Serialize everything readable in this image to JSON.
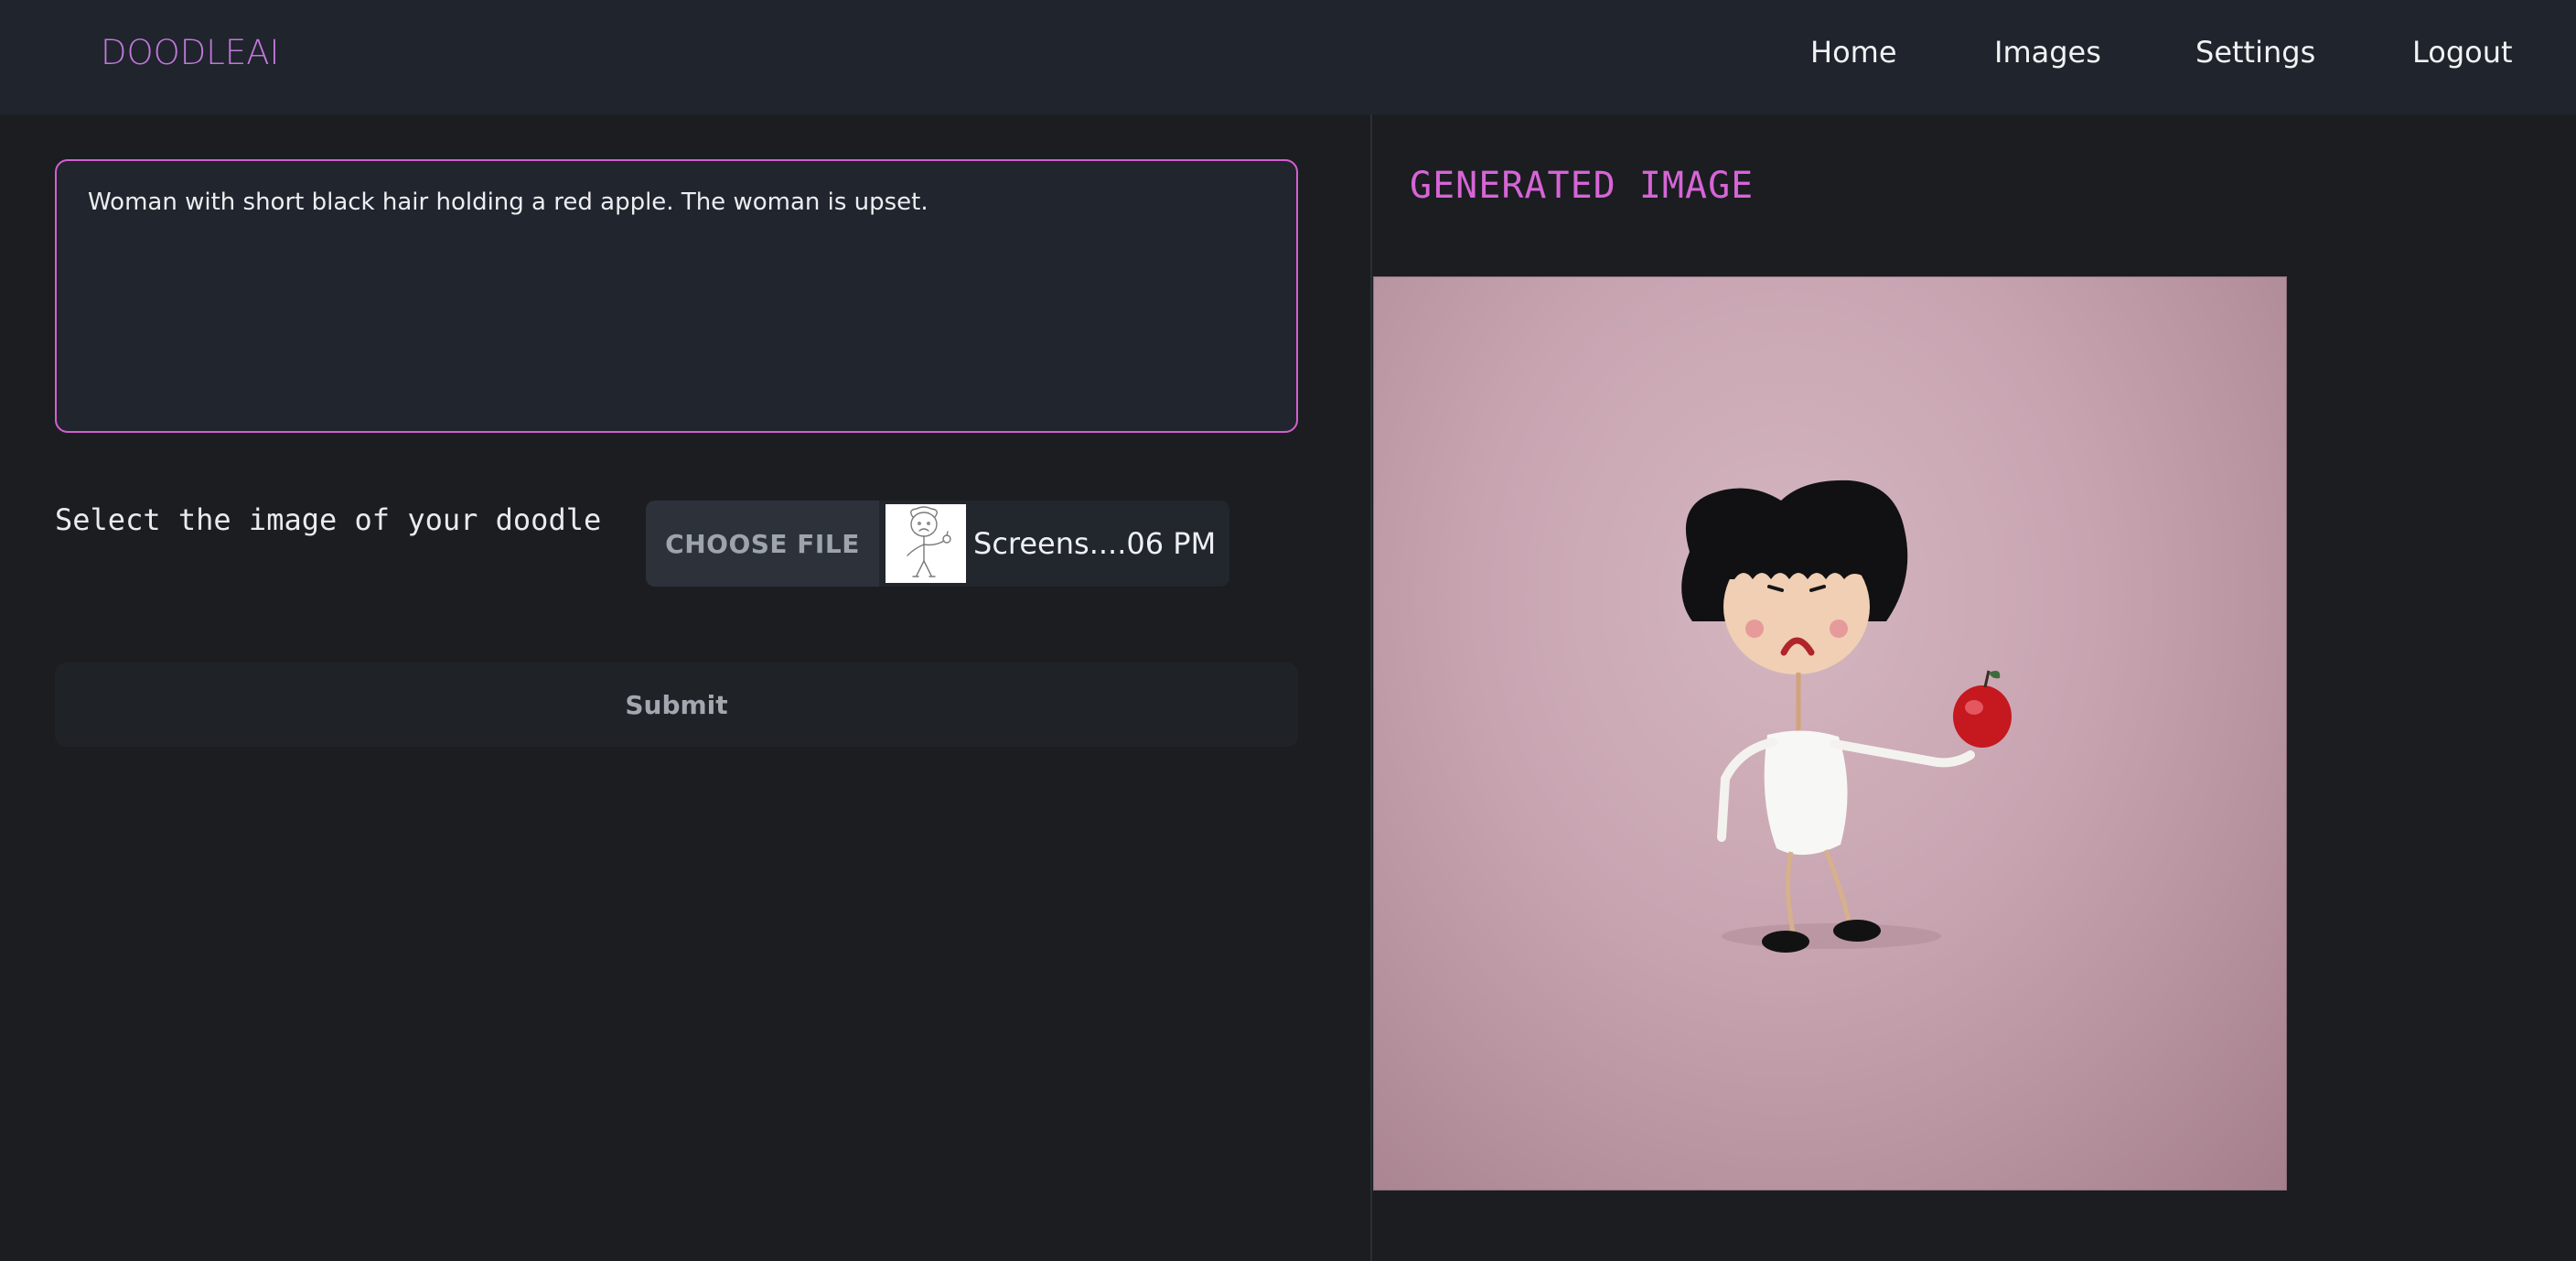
{
  "brand": {
    "name": "DOODLEAI",
    "color": "#c178dd"
  },
  "nav": {
    "home": "Home",
    "images": "Images",
    "settings": "Settings",
    "logout": "Logout"
  },
  "form": {
    "prompt_value": "Woman with short black hair holding a red apple. The woman is upset.",
    "select_label": "Select the image of your doodle",
    "choose_file_label": "CHOOSE FILE",
    "file_name": "Screens....06 PM",
    "submit_label": "Submit"
  },
  "result": {
    "title": "GENERATED IMAGE",
    "title_color": "#d665d6"
  },
  "colors": {
    "accent_border": "#d35fd2",
    "background": "#1b1d21",
    "topbar": "#20242c"
  },
  "icons": {
    "doodle_thumbnail": "stick-figure-sketch"
  }
}
